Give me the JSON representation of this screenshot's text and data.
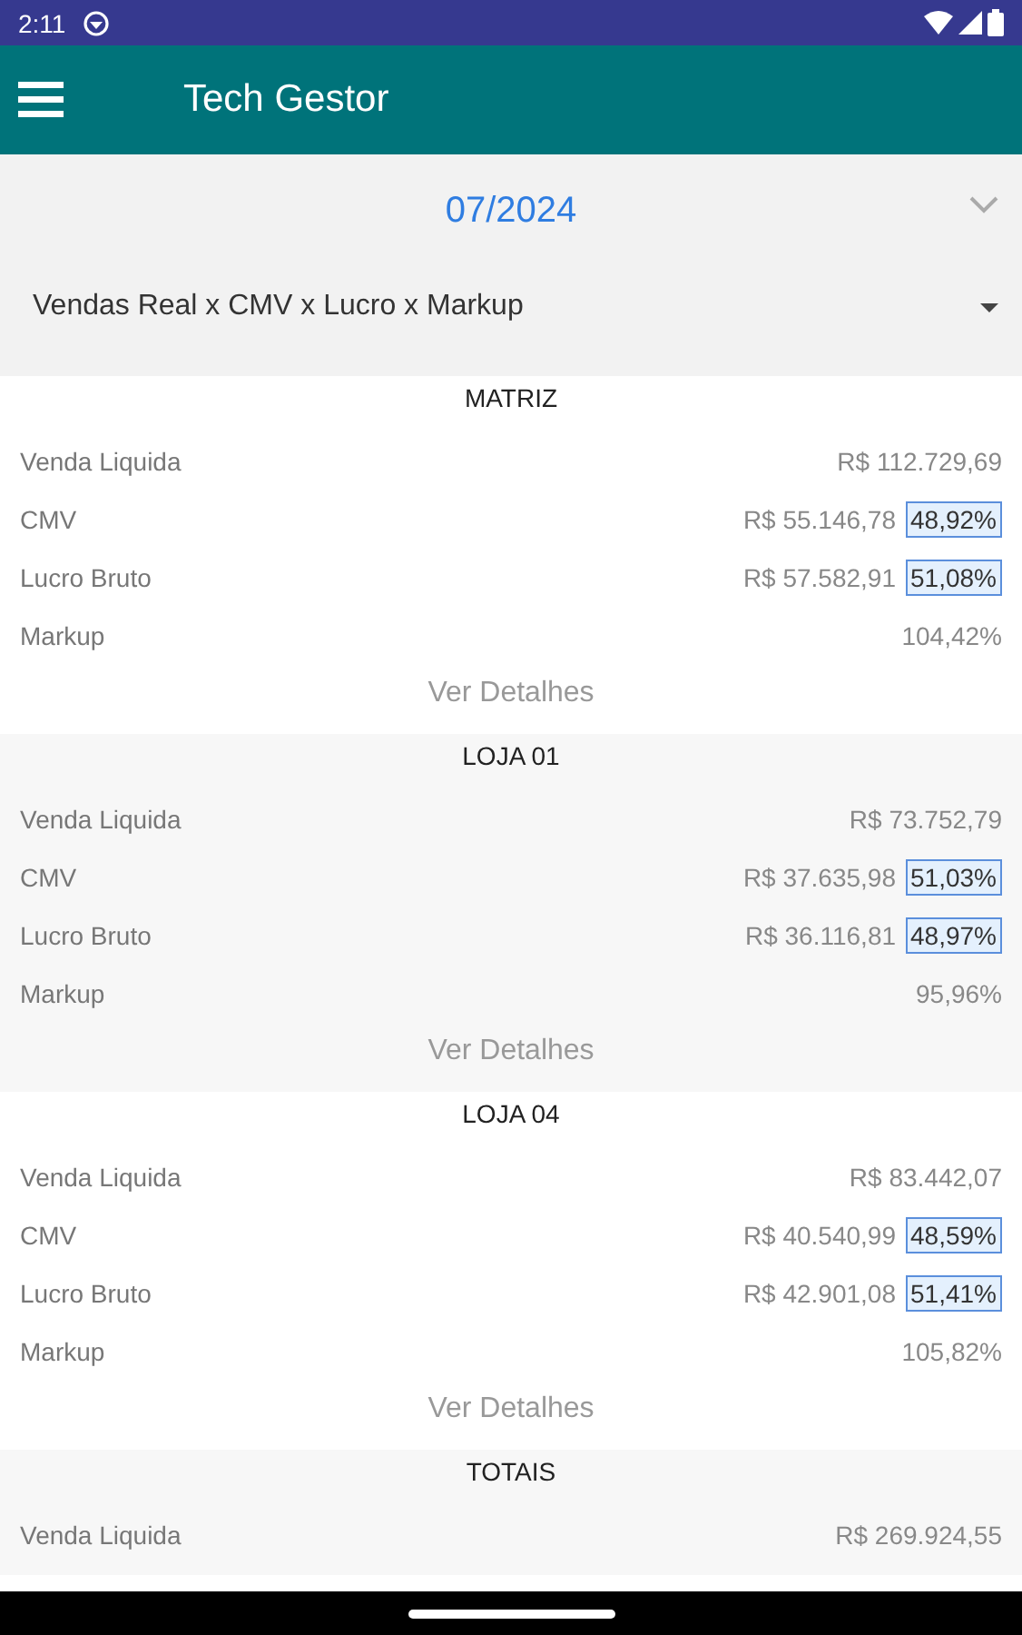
{
  "status_bar": {
    "time": "2:11"
  },
  "app_bar": {
    "title": "Tech Gestor"
  },
  "period": {
    "value": "07/2024"
  },
  "report_select": {
    "value": "Vendas Real x CMV x Lucro x Markup"
  },
  "sections": [
    {
      "title": "MATRIZ",
      "rows": [
        {
          "label": "Venda Liquida",
          "value": "R$ 112.729,69"
        },
        {
          "label": "CMV",
          "value": "R$ 55.146,78",
          "share": "48,92%"
        },
        {
          "label": "Lucro Bruto",
          "value": "R$ 57.582,91",
          "share": "51,08%"
        },
        {
          "label": "Markup",
          "value": "104,42%"
        }
      ],
      "link": "Ver Detalhes"
    },
    {
      "title": "LOJA 01",
      "rows": [
        {
          "label": "Venda Liquida",
          "value": "R$ 73.752,79"
        },
        {
          "label": "CMV",
          "value": "R$ 37.635,98",
          "share": "51,03%"
        },
        {
          "label": "Lucro Bruto",
          "value": "R$ 36.116,81",
          "share": "48,97%"
        },
        {
          "label": "Markup",
          "value": "95,96%"
        }
      ],
      "link": "Ver Detalhes"
    },
    {
      "title": "LOJA 04",
      "rows": [
        {
          "label": "Venda Liquida",
          "value": "R$ 83.442,07"
        },
        {
          "label": "CMV",
          "value": "R$ 40.540,99",
          "share": "48,59%"
        },
        {
          "label": "Lucro Bruto",
          "value": "R$ 42.901,08",
          "share": "51,41%"
        },
        {
          "label": "Markup",
          "value": "105,82%"
        }
      ],
      "link": "Ver Detalhes"
    },
    {
      "title": "TOTAIS",
      "rows": [
        {
          "label": "Venda Liquida",
          "value": "R$ 269.924,55"
        }
      ]
    }
  ]
}
